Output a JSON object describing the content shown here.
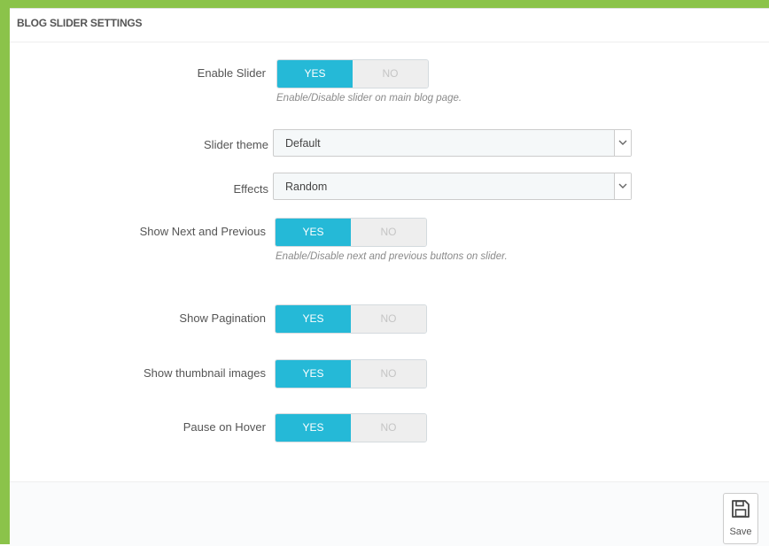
{
  "panel": {
    "title": "BLOG SLIDER SETTINGS"
  },
  "fields": {
    "enable_slider": {
      "label": "Enable Slider",
      "yes": "YES",
      "no": "NO",
      "value": "YES",
      "help": "Enable/Disable slider on main blog page."
    },
    "slider_theme": {
      "label": "Slider theme",
      "value": "Default"
    },
    "effects": {
      "label": "Effects",
      "value": "Random"
    },
    "show_next_prev": {
      "label": "Show Next and Previous",
      "yes": "YES",
      "no": "NO",
      "value": "YES",
      "help": "Enable/Disable next and previous buttons on slider."
    },
    "show_pagination": {
      "label": "Show Pagination",
      "yes": "YES",
      "no": "NO",
      "value": "YES"
    },
    "show_thumbnails": {
      "label": "Show thumbnail images",
      "yes": "YES",
      "no": "NO",
      "value": "YES"
    },
    "pause_on_hover": {
      "label": "Pause on Hover",
      "yes": "YES",
      "no": "NO",
      "value": "YES"
    }
  },
  "footer": {
    "save_label": "Save"
  },
  "colors": {
    "accent": "#25b9d7",
    "frame": "#8bc34a",
    "switch_off_bg": "#eeeeee"
  },
  "icons": {
    "save": "floppy-disk-icon",
    "select_caret": "chevron-down-icon"
  }
}
